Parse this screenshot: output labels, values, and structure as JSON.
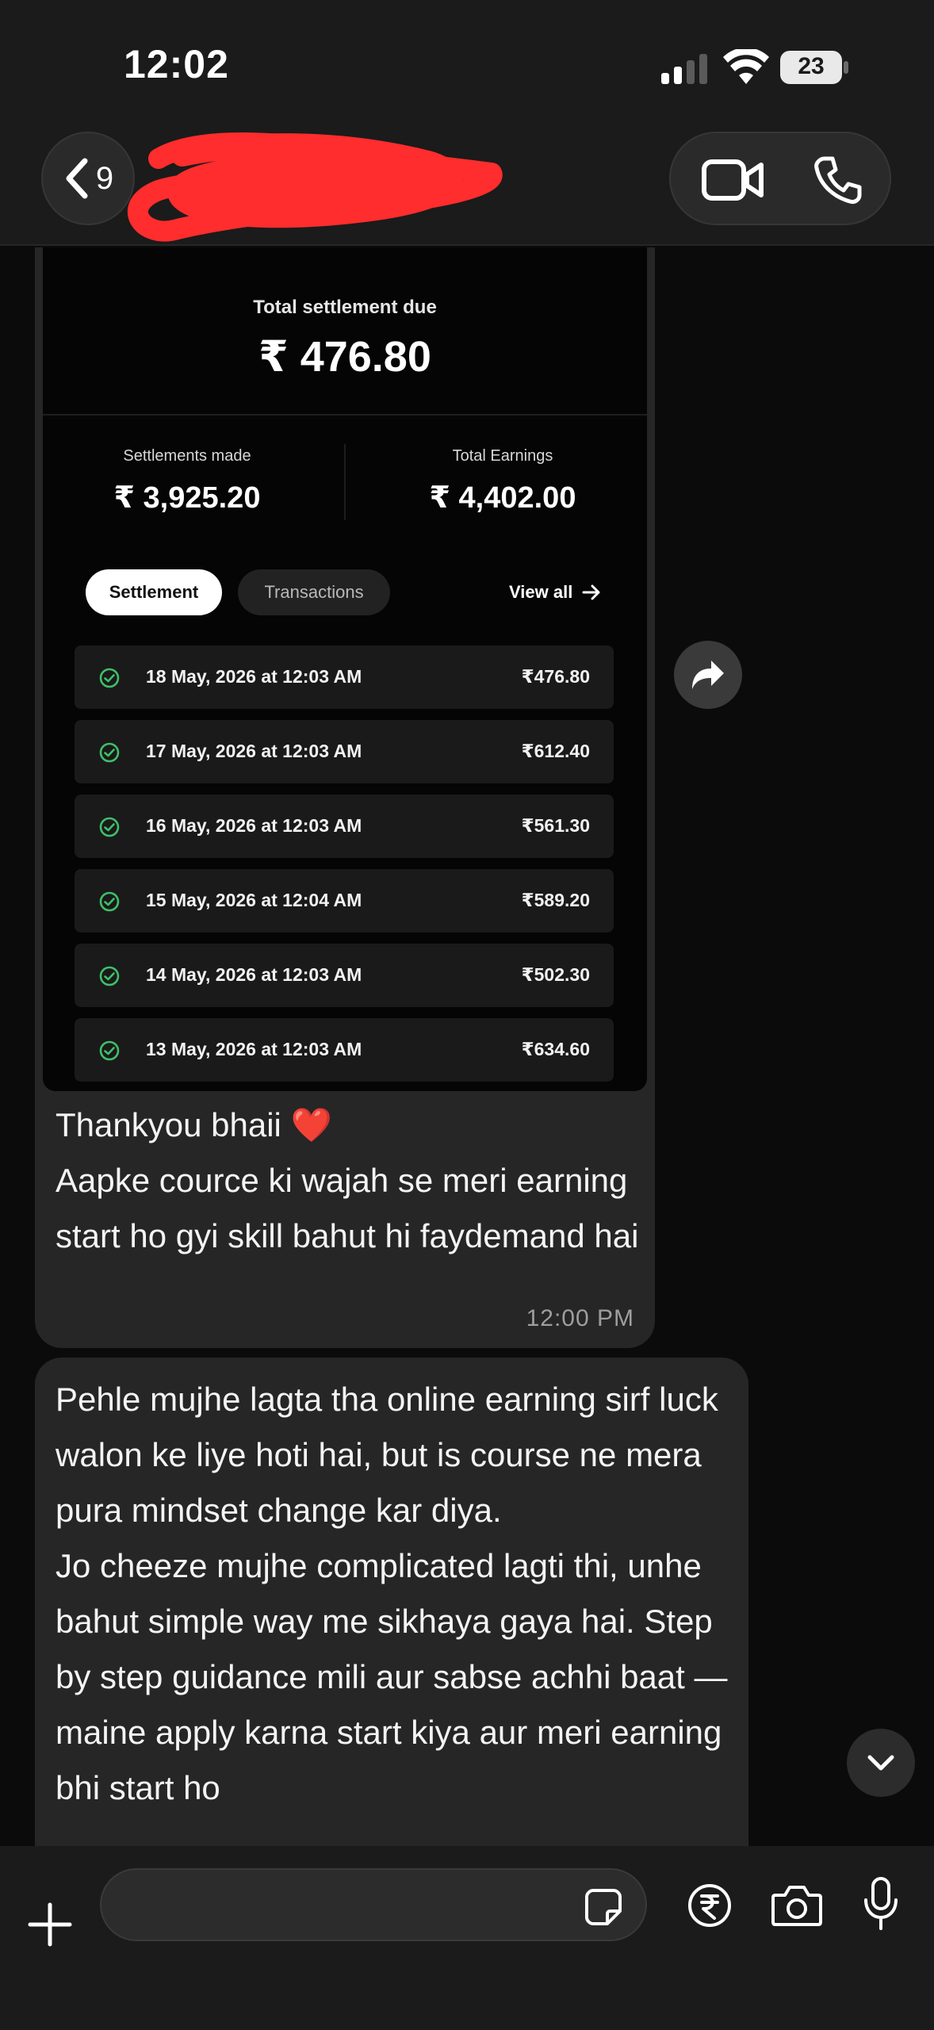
{
  "status_bar": {
    "time": "12:02",
    "battery": "23"
  },
  "header": {
    "back_count": "9"
  },
  "shared_screenshot": {
    "total_label": "Total settlement due",
    "total_value": "₹ 476.80",
    "settlements_label": "Settlements made",
    "settlements_value": "₹ 3,925.20",
    "earnings_label": "Total Earnings",
    "earnings_value": "₹ 4,402.00",
    "tabs": [
      {
        "label": "Settlement",
        "active": true
      },
      {
        "label": "Transactions",
        "active": false
      }
    ],
    "view_all": "View all",
    "rows": [
      {
        "date": "18 May, 2026 at 12:03 AM",
        "amount": "₹476.80"
      },
      {
        "date": "17 May, 2026 at 12:03 AM",
        "amount": "₹612.40"
      },
      {
        "date": "16 May, 2026 at 12:03 AM",
        "amount": "₹561.30"
      },
      {
        "date": "15 May, 2026 at 12:04 AM",
        "amount": "₹589.20"
      },
      {
        "date": "14 May, 2026 at 12:03 AM",
        "amount": "₹502.30"
      },
      {
        "date": "13 May, 2026 at 12:03 AM",
        "amount": "₹634.60"
      }
    ]
  },
  "messages": [
    {
      "line1": "Thankyou bhaii",
      "emoji": "❤️",
      "body": "Aapke cource ki wajah se meri earning start ho gyi skill bahut hi faydemand hai",
      "time": "12:00 PM"
    },
    {
      "body": "Pehle mujhe lagta tha online earning sirf luck walon ke liye hoti hai, but is course ne mera pura mindset change kar diya.\nJo cheeze mujhe complicated lagti thi, unhe bahut simple way me sikhaya gaya hai. Step by step guidance mili aur sabse achhi baat — maine apply karna start kiya aur meri earning bhi start ho"
    }
  ],
  "composer": {
    "placeholder": ""
  },
  "icons": {
    "back": "chevron-left-icon",
    "video": "video-camera-icon",
    "phone": "phone-icon",
    "forward": "share-arrow-icon",
    "scroll": "chevron-down-icon",
    "plus": "plus-icon",
    "sticker": "sticker-icon",
    "rupee": "rupee-icon",
    "camera": "camera-icon",
    "mic": "microphone-icon",
    "check": "check-circle-icon"
  },
  "colors": {
    "accent_check": "#3fbf6a",
    "redaction": "#ff3b30",
    "bubble": "#262626"
  }
}
